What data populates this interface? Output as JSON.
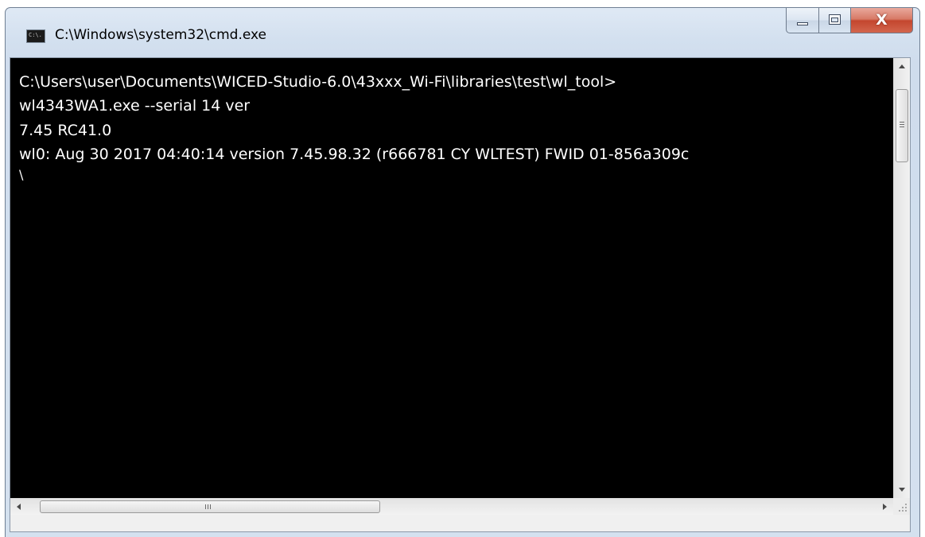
{
  "window": {
    "title": "C:\\Windows\\system32\\cmd.exe",
    "icon": "cmd-icon",
    "icon_text": "C:\\."
  },
  "caption_buttons": {
    "minimize": "minimize-icon",
    "maximize": "maximize-icon",
    "close": "close-icon",
    "close_glyph": "X"
  },
  "console": {
    "background": "#000000",
    "foreground": "#ffffff",
    "lines": [
      "C:\\Users\\user\\Documents\\WICED-Studio-6.0\\43xxx_Wi-Fi\\libraries\\test\\wl_tool>",
      "wl4343WA1.exe --serial 14 ver",
      "7.45 RC41.0",
      "wl0: Aug 30 2017 04:40:14 version 7.45.98.32 (r666781 CY WLTEST) FWID 01-856a309c",
      "\\"
    ]
  },
  "scrollbars": {
    "vertical": {
      "up": "scroll-up-arrow-icon",
      "down": "scroll-down-arrow-icon"
    },
    "horizontal": {
      "left": "scroll-left-arrow-icon",
      "right": "scroll-right-arrow-icon",
      "grip_text": "III"
    }
  },
  "colors": {
    "close_button": "#c4462e",
    "titlebar": "#d3e0ef"
  }
}
